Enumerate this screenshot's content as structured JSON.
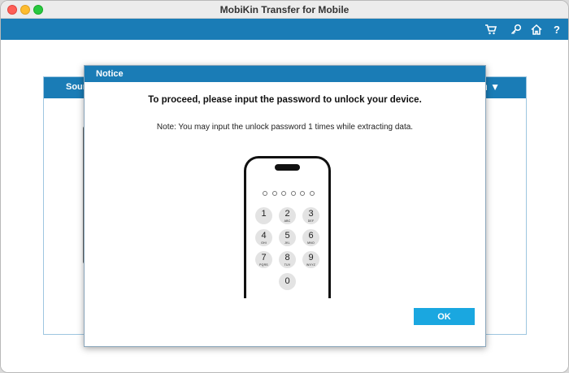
{
  "window": {
    "title": "MobiKin Transfer for Mobile"
  },
  "toolbar": {
    "icons": [
      "cart-icon",
      "key-icon",
      "home-icon",
      "help-icon"
    ]
  },
  "background_panel": {
    "left_label": "Sour",
    "right_label": "u ▼"
  },
  "dialog": {
    "title": "Notice",
    "heading": "To proceed, please input the password to unlock your device.",
    "note": "Note: You may input the unlock password 1 times while extracting data.",
    "ok_label": "OK"
  },
  "keypad": [
    {
      "num": "1",
      "letters": ""
    },
    {
      "num": "2",
      "letters": "ABC"
    },
    {
      "num": "3",
      "letters": "DEF"
    },
    {
      "num": "4",
      "letters": "GHI"
    },
    {
      "num": "5",
      "letters": "JKL"
    },
    {
      "num": "6",
      "letters": "MNO"
    },
    {
      "num": "7",
      "letters": "PQRS"
    },
    {
      "num": "8",
      "letters": "TUV"
    },
    {
      "num": "9",
      "letters": "WXYZ"
    },
    {
      "num": "0",
      "letters": ""
    }
  ],
  "colors": {
    "accent": "#1a7cb6",
    "ok_button": "#1aa7e0"
  }
}
